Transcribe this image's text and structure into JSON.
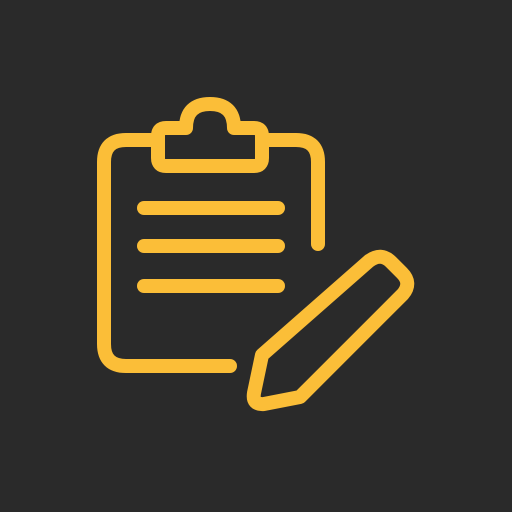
{
  "icon": {
    "name": "clipboard-edit-icon",
    "parts": [
      "clipboard-body",
      "clipboard-clip",
      "text-line-1",
      "text-line-2",
      "text-line-3",
      "pencil"
    ]
  },
  "colors": {
    "background": "#2a2a2a",
    "accent": "#fbbe38"
  }
}
